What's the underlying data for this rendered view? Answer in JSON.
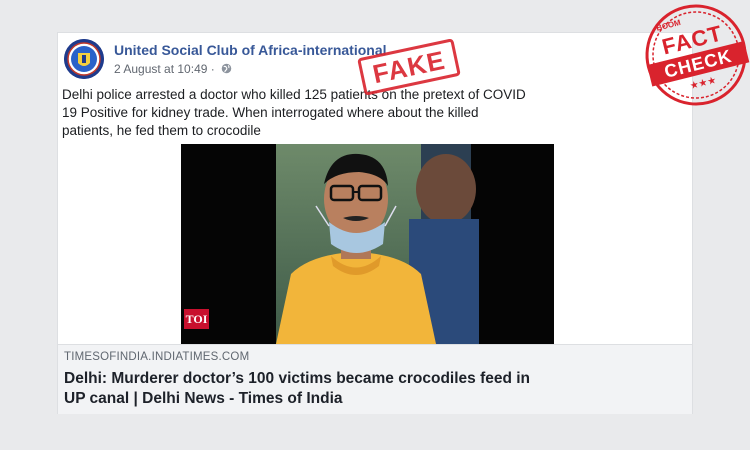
{
  "post": {
    "page_name": "United Social Club of Africa-international",
    "timestamp": "2 August at 10:49",
    "separator": "·",
    "privacy_icon": "globe-icon",
    "text": "Delhi police arrested a doctor who killed 125 patients on the pretext of COVID 19 Positive for kidney trade. When interrogated where about the killed patients, he fed them to crocodile"
  },
  "photo": {
    "logo_text": "TOI"
  },
  "link_preview": {
    "domain": "TIMESOFINDIA.INDIATIMES.COM",
    "headline": "Delhi: Murderer doctor’s 100 victims became crocodiles feed in UP canal | Delhi News - Times of India"
  },
  "stamps": {
    "fake_label": "FAKE",
    "fc_brand": "BOOM",
    "fc_line1": "FACT",
    "fc_line2": "CHECK",
    "fc_stars": "★★★"
  },
  "colors": {
    "link_blue": "#385898",
    "stamp_red": "#d9232d",
    "avatar_blue": "#1f3b8c",
    "shirt_yellow": "#f2b53a"
  }
}
